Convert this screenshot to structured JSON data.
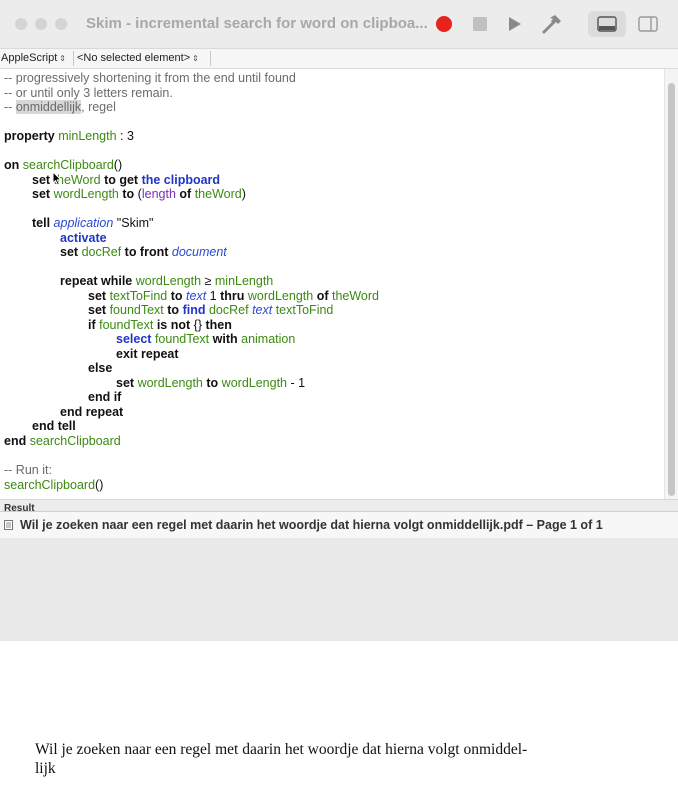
{
  "window": {
    "title": "Skim - incremental search for word on clipboa..."
  },
  "toolbar": {
    "record_icon": "record-icon",
    "stop_icon": "stop-icon",
    "run_icon": "run-icon",
    "compile_icon": "hammer-icon",
    "view_bottom_icon": "bottom-panel-icon",
    "view_side_icon": "side-panel-icon",
    "colors": {
      "record": "#e8231d",
      "disabled": "#b9b9b9",
      "active": "#707070"
    }
  },
  "navbar": {
    "language": "AppleScript",
    "element": "<No selected element>"
  },
  "script": {
    "l1": "-- progressively shortening it from the end until found",
    "l2": "-- or until only 3 letters remain.",
    "l3a": "-- ",
    "l3b": "onmiddellijk",
    "l3c": ", regel",
    "l4a": "property",
    "l4b": "minLength",
    "l4c": " : 3",
    "l5a": "on",
    "l5b": "searchClipboard",
    "l5c": "()",
    "l6a": "set",
    "l6b": "theWord",
    "l6c": "to get",
    "l6d": "the clipboard",
    "l7a": "set",
    "l7b": "wordLength",
    "l7c": "to",
    "l7d": "(",
    "l7e": "length",
    "l7f": "of",
    "l7g": "theWord",
    "l7h": ")",
    "l8a": "tell",
    "l8b": "application",
    "l8c": "\"Skim\"",
    "l9": "activate",
    "l10a": "set",
    "l10b": "docRef",
    "l10c": "to front",
    "l10d": "document",
    "l11a": "repeat while",
    "l11b": "wordLength",
    "l11c": " ≥ ",
    "l11d": "minLength",
    "l12a": "set",
    "l12b": "textToFind",
    "l12c": "to",
    "l12d": "text",
    "l12e": " 1 ",
    "l12f": "thru",
    "l12g": "wordLength",
    "l12h": "of",
    "l12i": "theWord",
    "l13a": "set",
    "l13b": "foundText",
    "l13c": "to",
    "l13d": "find",
    "l13e": "docRef",
    "l13f": "text",
    "l13g": "textToFind",
    "l14a": "if",
    "l14b": "foundText",
    "l14c": "is not",
    "l14d": " {} ",
    "l14e": "then",
    "l15a": "select",
    "l15b": "foundText",
    "l15c": "with",
    "l15d": "animation",
    "l16": "exit repeat",
    "l17": "else",
    "l18a": "set",
    "l18b": "wordLength",
    "l18c": "to",
    "l18d": "wordLength",
    "l18e": " - 1",
    "l19": "end if",
    "l20": "end repeat",
    "l21": "end tell",
    "l22a": "end",
    "l22b": "searchClipboard",
    "l23": "-- Run it:",
    "l24a": "searchClipboard",
    "l24b": "()",
    "colors": {
      "comment": "#6b6b6b",
      "variable": "#3b8a12",
      "command": "#1f35c5",
      "class": "#2a4ad0",
      "property": "#7a2fb8"
    }
  },
  "result": {
    "label": "Result",
    "value": "Wil je zoeken naar een regel met daarin het woordje dat hierna volgt onmiddellijk.pdf – Page 1 of 1",
    "icon": "document-icon"
  },
  "pdf": {
    "line1": "Wil je zoeken naar een regel met daarin het woordje dat hierna volgt onmiddel-",
    "line2": "lijk"
  }
}
